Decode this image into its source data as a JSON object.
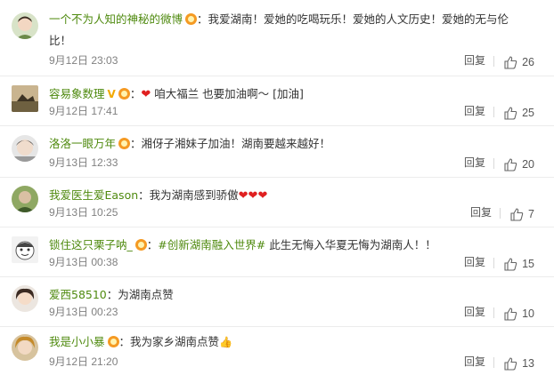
{
  "comments": [
    {
      "name": "一个不为人知的神秘的微博",
      "text_part1": "：我爱湖南！爱她的吃喝玩乐！爱她的人文历史！爱她的无与伦",
      "text_part2": "比！",
      "time": "9月12日 23:03",
      "reply": "回复",
      "likes": "26",
      "badge": "vip-badge-icon"
    },
    {
      "name": "容易象数理",
      "text_before": "：",
      "heart": "❤",
      "text_after": " 咱大福兰 也要加油啊～ [加油]",
      "time": "9月12日 17:41",
      "reply": "回复",
      "likes": "25"
    },
    {
      "name": "洛洛一眼万年",
      "text": "：湘伢子湘妹子加油！湖南要越来越好！",
      "time": "9月13日 12:33",
      "reply": "回复",
      "likes": "20"
    },
    {
      "name": "我爱医生爱Eason",
      "text": "：我为湖南感到骄傲",
      "hearts": "❤❤❤",
      "time": "9月13日 10:25",
      "reply": "回复",
      "likes": "7"
    },
    {
      "name": "锁住这只栗子呐_",
      "text_before": "：",
      "topic": "#创新湖南融入世界#",
      "text_after": " 此生无悔入华夏无悔为湖南人！！",
      "time": "9月13日 00:38",
      "reply": "回复",
      "likes": "15"
    },
    {
      "name": "爱西58510",
      "text": "：为湖南点赞",
      "time": "9月13日 00:23",
      "reply": "回复",
      "likes": "10"
    },
    {
      "name": "我是小小暴",
      "text": "：我为家乡湖南点赞",
      "time": "9月12日 21:20",
      "reply": "回复",
      "likes": "13"
    }
  ],
  "colors": {
    "name": "#4f8a0f",
    "meta": "#808080",
    "heart": "#e02020",
    "badge": "#f59a23"
  }
}
